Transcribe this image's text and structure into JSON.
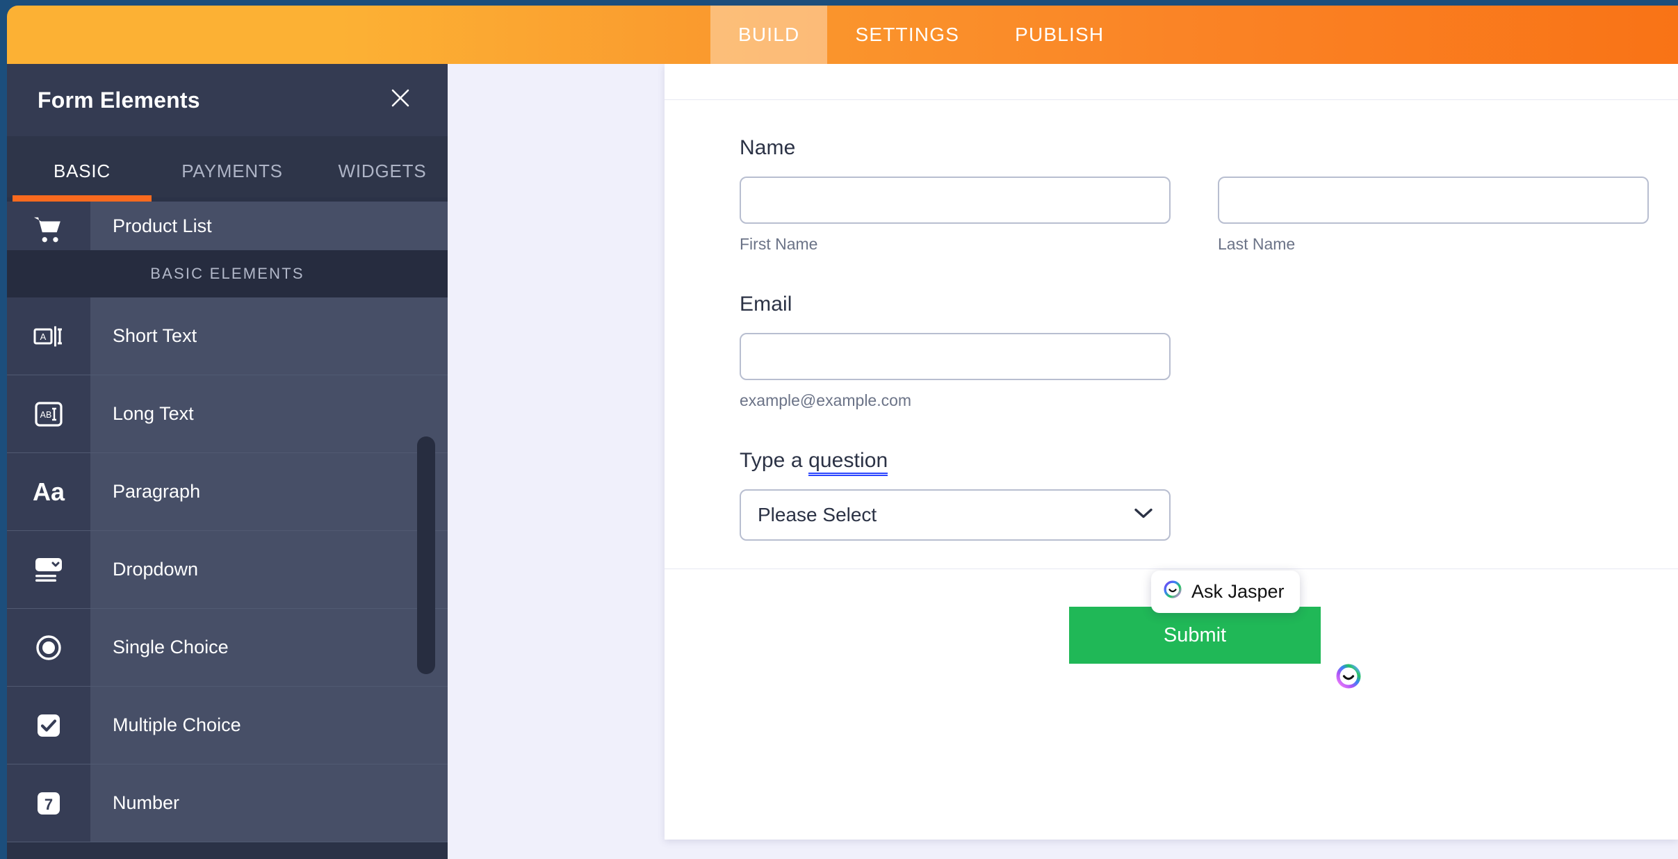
{
  "topnav": {
    "items": [
      {
        "label": "BUILD",
        "active": true
      },
      {
        "label": "SETTINGS",
        "active": false
      },
      {
        "label": "PUBLISH",
        "active": false
      }
    ]
  },
  "panel": {
    "title": "Form Elements",
    "close_icon": "close-icon",
    "tabs": [
      {
        "label": "BASIC",
        "active": true
      },
      {
        "label": "PAYMENTS",
        "active": false
      },
      {
        "label": "WIDGETS",
        "active": false
      }
    ],
    "section_heading": "BASIC ELEMENTS",
    "items_above": [
      {
        "label": "Product List",
        "icon": "shopping-cart-icon"
      }
    ],
    "items": [
      {
        "label": "Short Text",
        "icon": "short-text-icon"
      },
      {
        "label": "Long Text",
        "icon": "long-text-icon"
      },
      {
        "label": "Paragraph",
        "icon": "paragraph-icon"
      },
      {
        "label": "Dropdown",
        "icon": "dropdown-icon"
      },
      {
        "label": "Single Choice",
        "icon": "radio-button-icon"
      },
      {
        "label": "Multiple Choice",
        "icon": "checkbox-icon"
      },
      {
        "label": "Number",
        "icon": "number-icon"
      }
    ]
  },
  "form": {
    "name": {
      "label": "Name",
      "first_sub": "First Name",
      "last_sub": "Last Name",
      "first_value": "",
      "last_value": ""
    },
    "email": {
      "label": "Email",
      "sub": "example@example.com",
      "value": ""
    },
    "question": {
      "label_prefix": "Type a ",
      "label_highlight": "question",
      "selected_option": "Please Select",
      "chevron_icon": "chevron-down-icon"
    },
    "submit_label": "Submit"
  },
  "jasper": {
    "tooltip_label": "Ask Jasper",
    "icon": "jasper-avatar-icon"
  },
  "colors": {
    "accent_orange": "#fa6a1e",
    "topbar_orange": "#f97316",
    "panel_dark": "#2b3247",
    "row_bg": "#474f67",
    "submit_green": "#20b857",
    "highlight_blue": "#2b45ff",
    "window_border": "#1c4e7c"
  }
}
